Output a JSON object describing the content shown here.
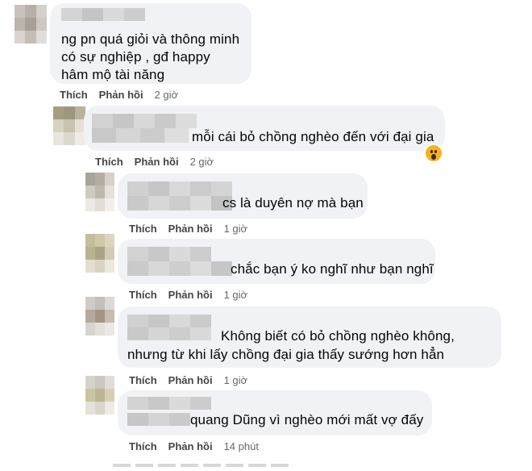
{
  "comments": [
    {
      "text_lines": [
        "ng pn quá giỏi và thông minh",
        "có sự nghiệp , gđ happy",
        "hâm mộ tài năng"
      ],
      "actions": {
        "like": "Thích",
        "reply": "Phản hồi",
        "time": "2 giờ"
      }
    },
    {
      "text_lines": [
        "mỗi cái bỏ chồng nghèo đến với đại gia"
      ],
      "reaction_icon": "wow-reaction-icon",
      "actions": {
        "like": "Thích",
        "reply": "Phản hồi",
        "time": "2 giờ"
      }
    },
    {
      "text_lines": [
        "cs là duyên nợ mà bạn"
      ],
      "actions": {
        "like": "Thích",
        "reply": "Phản hồi",
        "time": "1 giờ"
      }
    },
    {
      "text_lines": [
        "chắc bạn ý ko nghĩ như bạn nghĩ"
      ],
      "actions": {
        "like": "Thích",
        "reply": "Phản hồi",
        "time": "1 giờ"
      }
    },
    {
      "text_lines": [
        "Không biết có bỏ chồng nghèo không,",
        "nhưng từ khi lấy chồng đại gia thấy sướng hơn hẳn"
      ],
      "actions": {
        "like": "Thích",
        "reply": "Phản hồi",
        "time": "1 giờ"
      }
    },
    {
      "text_lines": [
        "quang Dũng vì nghèo mới mất vợ đấy"
      ],
      "actions": {
        "like": "Thích",
        "reply": "Phản hồi",
        "time": "14 phút"
      }
    }
  ],
  "colors": {
    "bubble": "#f0f2f5",
    "action_text": "#444444",
    "time_text": "#65676b",
    "reaction": "#f7b125"
  }
}
